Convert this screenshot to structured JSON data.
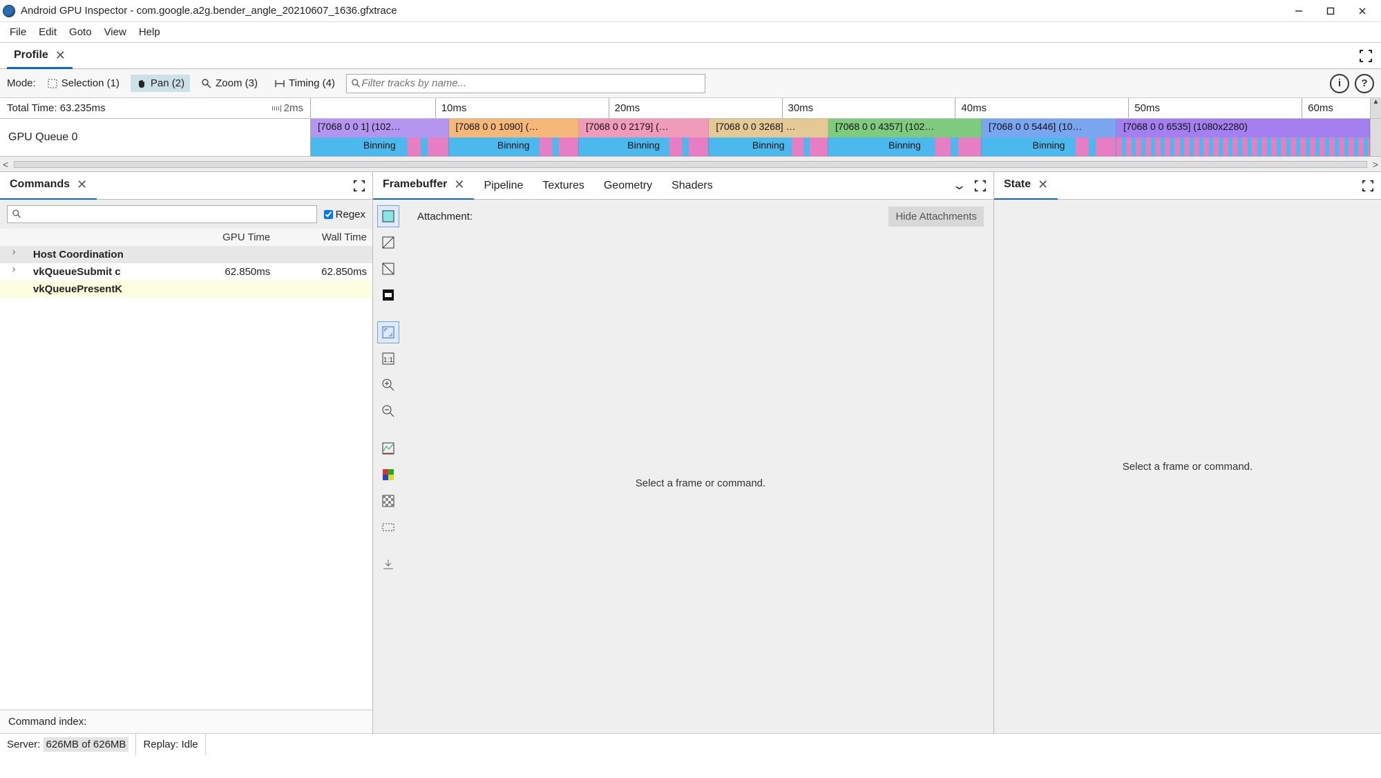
{
  "window": {
    "title": "Android GPU Inspector - com.google.a2g.bender_angle_20210607_1636.gfxtrace"
  },
  "menu": {
    "file": "File",
    "edit": "Edit",
    "goto": "Goto",
    "view": "View",
    "help": "Help"
  },
  "profile_tab": {
    "label": "Profile"
  },
  "mode": {
    "label": "Mode:",
    "selection": "Selection (1)",
    "pan": "Pan (2)",
    "zoom": "Zoom (3)",
    "timing": "Timing (4)",
    "filter_placeholder": "Filter tracks by name..."
  },
  "timeline": {
    "total_time_label": "Total Time: 63.235ms",
    "scale_tick": "2ms",
    "ticks": [
      "10ms",
      "20ms",
      "30ms",
      "40ms",
      "50ms",
      "60ms"
    ],
    "queue_label": "GPU Queue 0",
    "blocks": [
      {
        "label": "[7068 0 0 1] (102…"
      },
      {
        "label": "[7068 0 0 1090] (…"
      },
      {
        "label": "[7068 0 0 2179] (…"
      },
      {
        "label": "[7068 0 0 3268] …"
      },
      {
        "label": "[7068 0 0 4357] (102…"
      },
      {
        "label": "[7068 0 0 5446] (10…"
      },
      {
        "label": "[7068 0 0 6535] (1080x2280)"
      }
    ],
    "binning": "Binning"
  },
  "commands": {
    "tab": "Commands",
    "regex": "Regex",
    "col_gpu": "GPU Time",
    "col_wall": "Wall Time",
    "rows": [
      {
        "name": "Host Coordination",
        "gpu": "",
        "wall": ""
      },
      {
        "name": "vkQueueSubmit c",
        "gpu": "62.850ms",
        "wall": "62.850ms"
      },
      {
        "name": "vkQueuePresentK",
        "gpu": "",
        "wall": ""
      }
    ],
    "index_label": "Command index:"
  },
  "center_tabs": {
    "framebuffer": "Framebuffer",
    "pipeline": "Pipeline",
    "textures": "Textures",
    "geometry": "Geometry",
    "shaders": "Shaders"
  },
  "framebuffer": {
    "attachment": "Attachment:",
    "hide": "Hide Attachments",
    "placeholder": "Select a frame or command."
  },
  "state": {
    "tab": "State",
    "placeholder": "Select a frame or command."
  },
  "status": {
    "server_label": "Server:",
    "server_mem": "626MB of 626MB",
    "replay": "Replay: Idle"
  }
}
